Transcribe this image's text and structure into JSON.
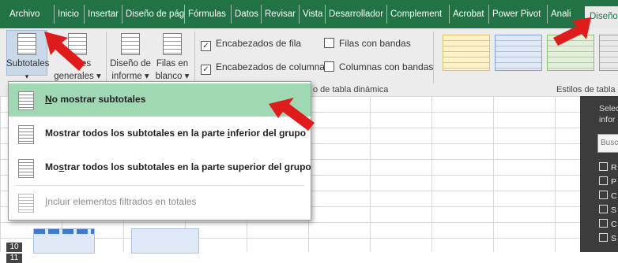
{
  "tabs": [
    "Archivo",
    "Inicio",
    "Insertar",
    "Diseño de pág",
    "Fórmulas",
    "Datos",
    "Revisar",
    "Vista",
    "Desarrollador",
    "Complement",
    "Acrobat",
    "Power Pivot",
    "Anali",
    "Diseño"
  ],
  "ribbon": {
    "subtotals_label": "Subtotales",
    "totals_label_1": "es",
    "totals_label_2": "generales ▾",
    "report_layout_1": "Diseño de",
    "report_layout_2": "informe ▾",
    "blank_rows_1": "Filas en",
    "blank_rows_2": "blanco ▾",
    "options": {
      "row_headers": "Encabezados de fila",
      "column_headers": "Encabezados de columna",
      "banded_rows": "Filas con bandas",
      "banded_columns": "Columnas con bandas"
    },
    "group_options_label": "o de tabla dinámica",
    "group_styles_label": "Estilos de tabla"
  },
  "dropdown": {
    "items": [
      {
        "label": "No mostrar subtotales",
        "mnemonic": "N"
      },
      {
        "label": "Mostrar todos los subtotales en la parte inferior del grupo",
        "mnemonic": "i"
      },
      {
        "label": "Mostrar todos los subtotales en la parte superior del grupo",
        "mnemonic": "s"
      },
      {
        "label": "Incluir elementos filtrados en totales",
        "mnemonic": "I"
      }
    ]
  },
  "rows": [
    "10",
    "11"
  ],
  "right_pane": {
    "text_1": "Selec",
    "text_2": "infor",
    "search": "Busc",
    "items": [
      "R",
      "P",
      "C",
      "S",
      "C",
      "S"
    ]
  },
  "colors": {
    "tab_bar": "#217346",
    "highlight": "#9fd8b3",
    "arrow": "#e01b1b"
  }
}
